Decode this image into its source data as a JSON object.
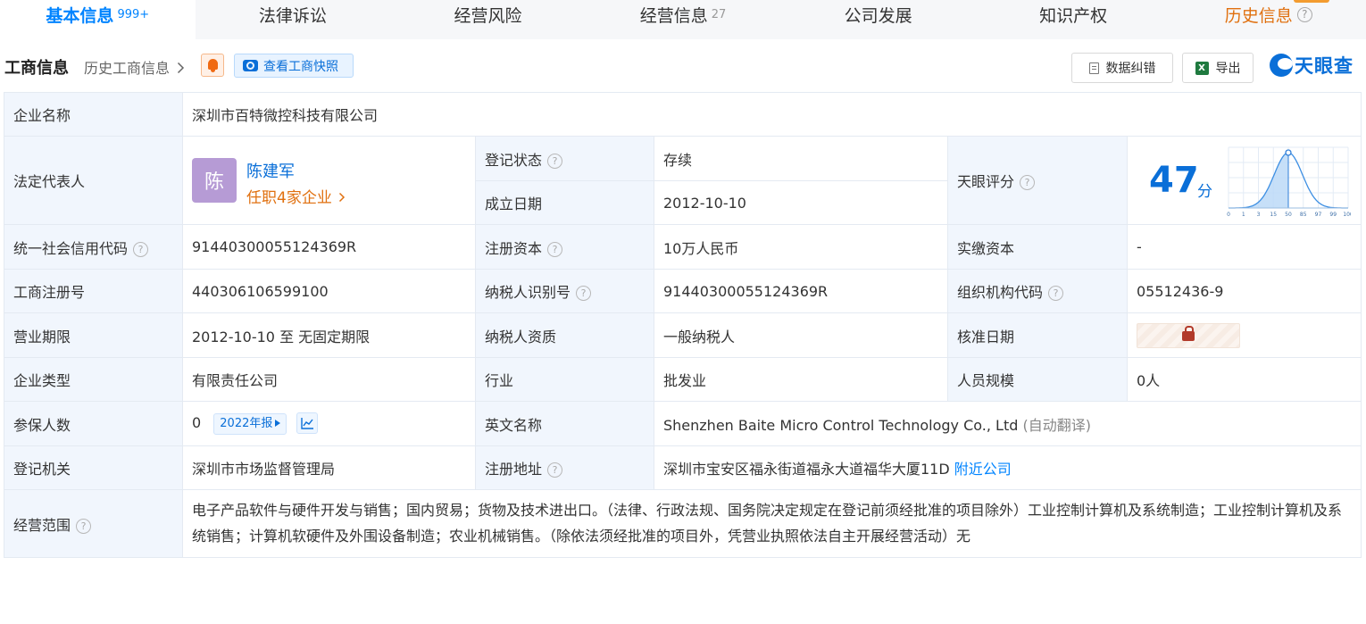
{
  "tabs": [
    {
      "label": "基本信息",
      "count": "999+"
    },
    {
      "label": "法律诉讼",
      "count": ""
    },
    {
      "label": "经营风险",
      "count": ""
    },
    {
      "label": "经营信息",
      "count": "27"
    },
    {
      "label": "公司发展",
      "count": ""
    },
    {
      "label": "知识产权",
      "count": ""
    },
    {
      "label": "历史信息",
      "count": ""
    }
  ],
  "header": {
    "title": "工商信息",
    "history_link": "历史工商信息",
    "snapshot_button": "查看工商快照",
    "correct_button": "数据纠错",
    "export_button": "导出",
    "logo_text": "天眼查",
    "xls_icon_text": "X"
  },
  "company": {
    "name_label": "企业名称",
    "name": "深圳市百特微控科技有限公司",
    "rep_label": "法定代表人",
    "rep_avatar": "陈",
    "rep_name": "陈建军",
    "rep_companies": "任职4家企业",
    "status_label": "登记状态",
    "status": "存续",
    "found_label": "成立日期",
    "found_date": "2012-10-10",
    "score_label": "天眼评分",
    "score": "47",
    "score_unit": "分",
    "credit_label": "统一社会信用代码",
    "credit_code": "91440300055124369R",
    "capital_label": "注册资本",
    "capital": "10万人民币",
    "paid_label": "实缴资本",
    "paid": "-",
    "reg_no_label": "工商注册号",
    "reg_no": "440306106599100",
    "tax_id_label": "纳税人识别号",
    "tax_id": "91440300055124369R",
    "org_code_label": "组织机构代码",
    "org_code": "05512436-9",
    "term_label": "营业期限",
    "term": "2012-10-10 至 无固定期限",
    "tax_qual_label": "纳税人资质",
    "tax_qual": "一般纳税人",
    "approve_label": "核准日期",
    "type_label": "企业类型",
    "type": "有限责任公司",
    "industry_label": "行业",
    "industry": "批发业",
    "staff_label": "人员规模",
    "staff": "0人",
    "insured_label": "参保人数",
    "insured": "0",
    "insured_year": "2022年报",
    "en_label": "英文名称",
    "en_name": "Shenzhen Baite Micro Control Technology Co., Ltd",
    "en_note": "(自动翻译)",
    "authority_label": "登记机关",
    "authority": "深圳市市场监督管理局",
    "address_label": "注册地址",
    "address": "深圳市宝安区福永街道福永大道福华大厦11D",
    "nearby": "附近公司",
    "scope_label": "经营范围",
    "scope": "电子产品软件与硬件开发与销售；国内贸易；货物及技术进出口。（法律、行政法规、国务院决定规定在登记前须经批准的项目除外）工业控制计算机及系统制造；工业控制计算机及系统销售；计算机软硬件及外围设备制造；农业机械销售。（除依法须经批准的项目外，凭营业执照依法自主开展经营活动）无"
  },
  "score_chart": {
    "ticks": [
      "0",
      "1",
      "3",
      "15",
      "50",
      "85",
      "97",
      "99",
      "100"
    ],
    "marker_tick": "50"
  },
  "colors": {
    "accent": "#0084ff",
    "brand": "#0a6fd8",
    "status_green": "#1a9e3c",
    "history_orange": "#e0700f"
  }
}
